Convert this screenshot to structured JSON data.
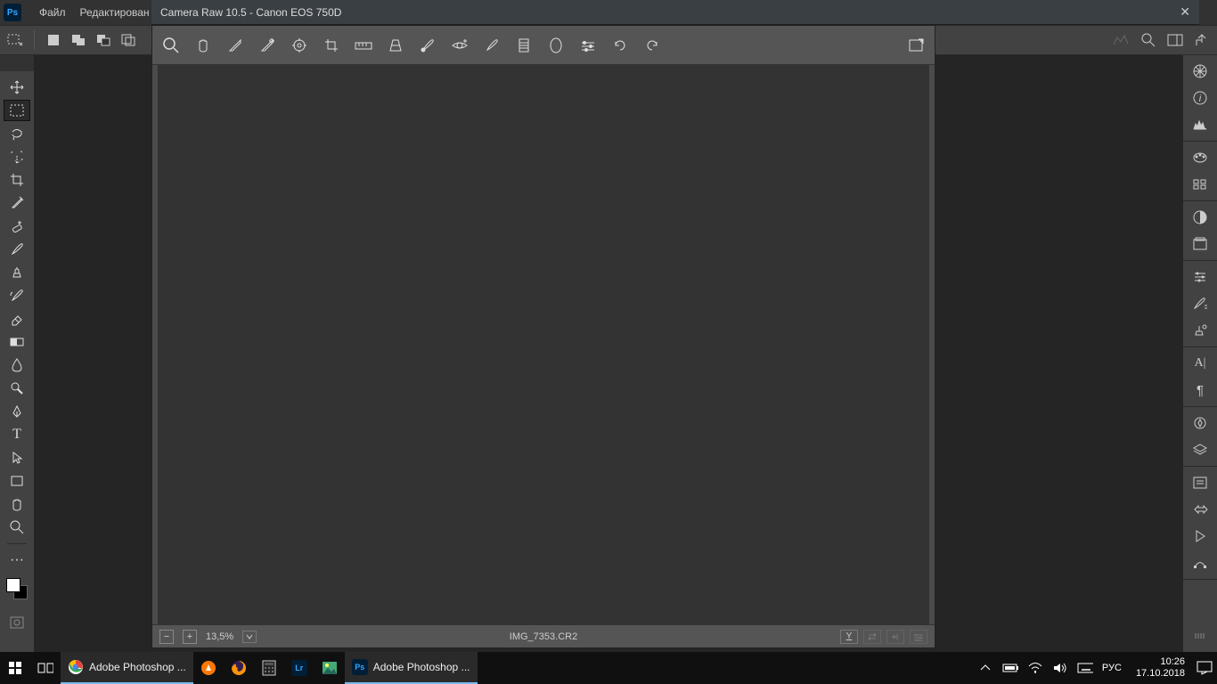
{
  "menubar": {
    "file": "Файл",
    "edit": "Редактирован"
  },
  "cameraRaw": {
    "title": "Camera Raw 10.5  -  Canon EOS 750D",
    "filename": "IMG_7353.CR2",
    "zoom": "13,5%",
    "previewToggle": "Y"
  },
  "taskbar": {
    "apps": {
      "chrome": "Adobe Photoshop ...",
      "photoshop": "Adobe Photoshop ..."
    },
    "lang": "РУС",
    "time": "10:26",
    "date": "17.10.2018"
  }
}
